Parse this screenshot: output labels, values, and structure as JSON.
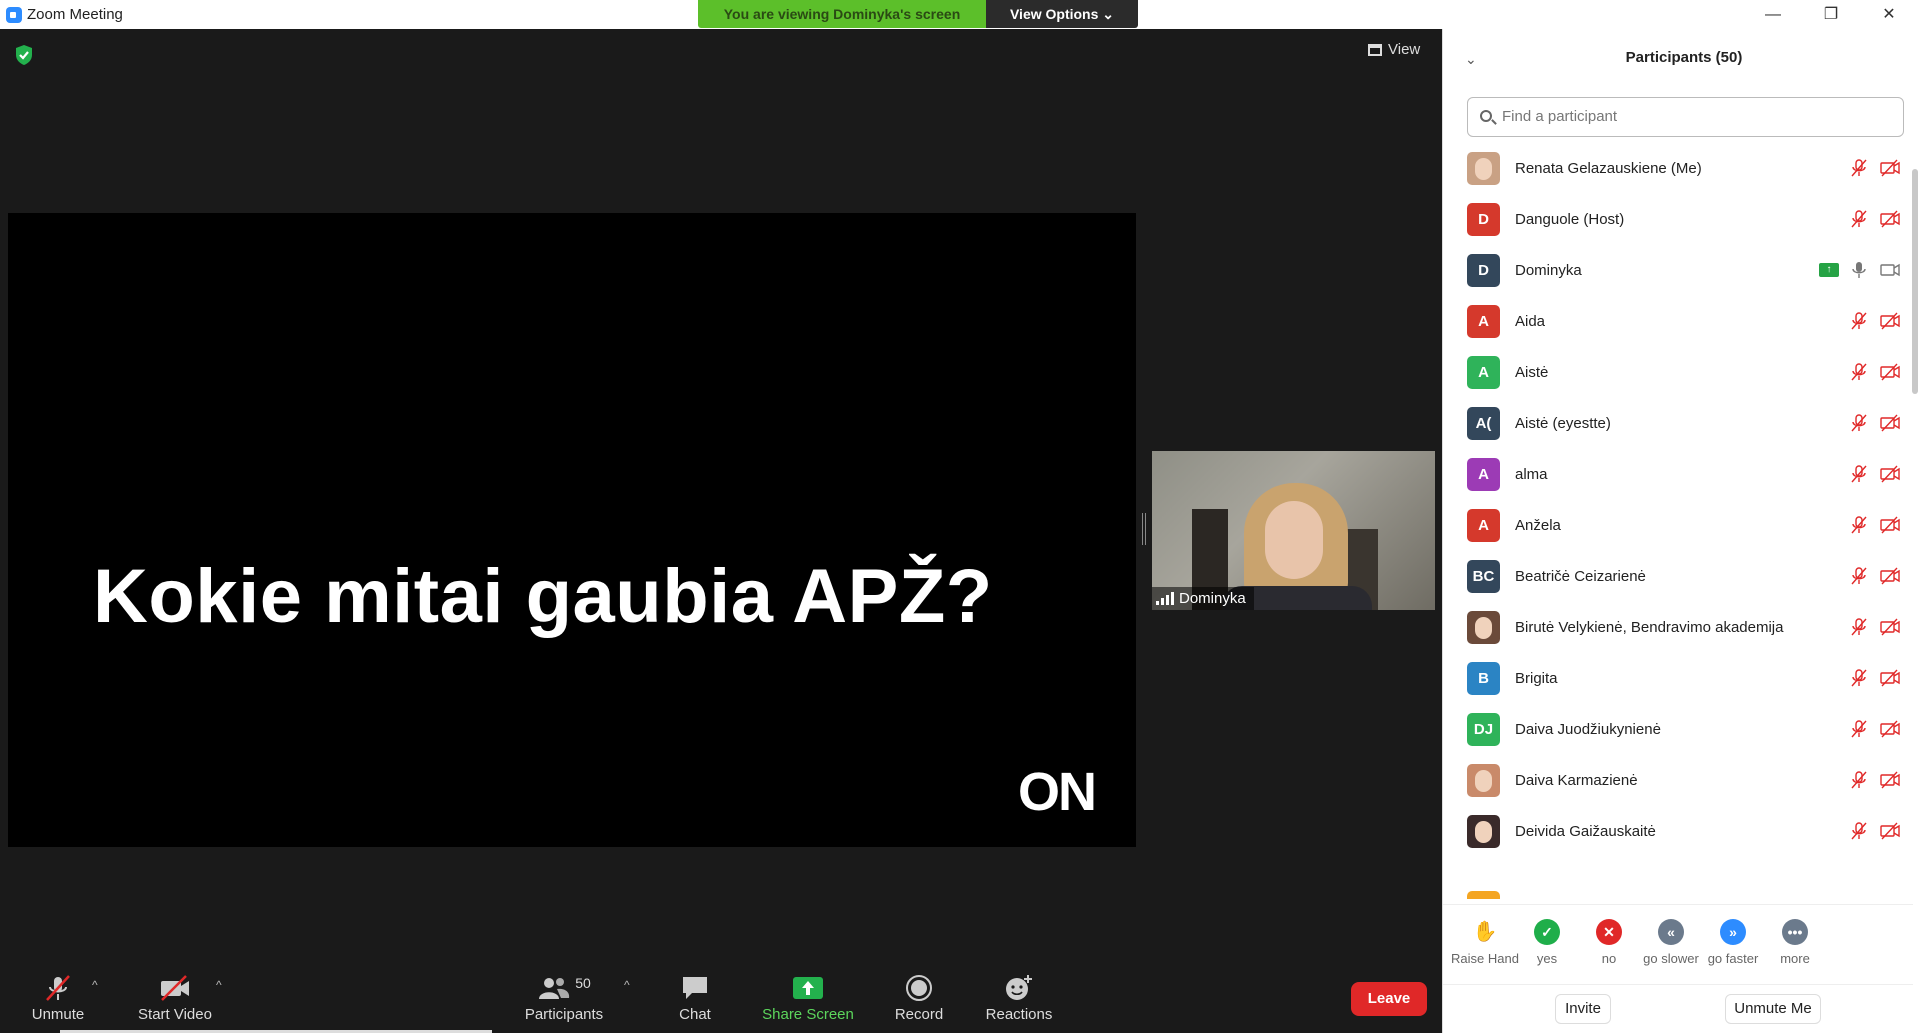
{
  "window": {
    "title": "Zoom Meeting"
  },
  "banner": {
    "viewing": "You are viewing Dominyka's screen",
    "view_options": "View Options ⌄"
  },
  "meeting": {
    "view_label": "View",
    "slide_text": "Kokie mitai gaubia APŽ?",
    "slide_logo": "ON",
    "thumbnail_name": "Dominyka"
  },
  "toolbar": {
    "unmute": "Unmute",
    "start_video": "Start Video",
    "participants": "Participants",
    "participants_count": "50",
    "chat": "Chat",
    "share_screen": "Share Screen",
    "record": "Record",
    "reactions": "Reactions",
    "leave": "Leave"
  },
  "panel": {
    "title": "Participants (50)",
    "search_placeholder": "Find a participant",
    "participants": [
      {
        "name": "Renata Gelazauskiene (Me)",
        "initials": "",
        "color": "#c9a184",
        "photo": true
      },
      {
        "name": "Danguole (Host)",
        "initials": "D",
        "color": "#d5392c"
      },
      {
        "name": "Dominyka",
        "initials": "D",
        "color": "#33475b",
        "sharing": true
      },
      {
        "name": "Aida",
        "initials": "A",
        "color": "#d5392c"
      },
      {
        "name": "Aistė",
        "initials": "A",
        "color": "#2fb35a"
      },
      {
        "name": "Aistė (eyestte)",
        "initials": "A(",
        "color": "#33475b"
      },
      {
        "name": "alma",
        "initials": "A",
        "color": "#9c3bb5"
      },
      {
        "name": "Anžela",
        "initials": "A",
        "color": "#d5392c"
      },
      {
        "name": "Beatričė Ceizarienė",
        "initials": "BC",
        "color": "#33475b"
      },
      {
        "name": "Birutė Velykienė, Bendravimo akademija",
        "initials": "",
        "color": "#6b4a3a",
        "photo": true
      },
      {
        "name": "Brigita",
        "initials": "B",
        "color": "#2b84c4"
      },
      {
        "name": "Daiva Juodžiukynienė",
        "initials": "DJ",
        "color": "#2fb35a"
      },
      {
        "name": "Daiva Karmazienė",
        "initials": "",
        "color": "#c98a6a",
        "photo": true
      },
      {
        "name": "Deivida Gaižauskaitė",
        "initials": "",
        "color": "#3a2a2a",
        "photo": true
      }
    ],
    "reactions": [
      {
        "label": "Raise Hand",
        "glyph": "✋",
        "color": "#2d8cff"
      },
      {
        "label": "yes",
        "glyph": "✓",
        "color": "#1fae4a"
      },
      {
        "label": "no",
        "glyph": "✕",
        "color": "#e02828"
      },
      {
        "label": "go slower",
        "glyph": "«",
        "color": "#6b7a8c"
      },
      {
        "label": "go faster",
        "glyph": "»",
        "color": "#2d8cff"
      },
      {
        "label": "more",
        "glyph": "•••",
        "color": "#6b7a8c"
      }
    ],
    "invite": "Invite",
    "unmute_me": "Unmute Me"
  }
}
